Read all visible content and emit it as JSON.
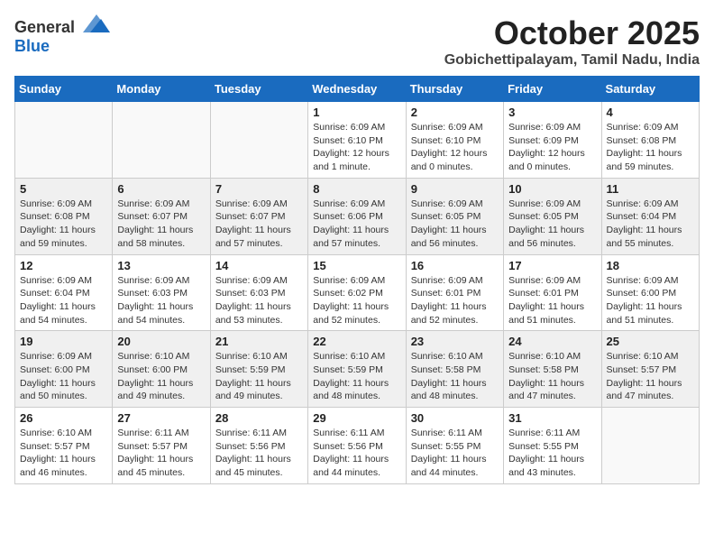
{
  "logo": {
    "general": "General",
    "blue": "Blue"
  },
  "title": "October 2025",
  "location": "Gobichettipalayam, Tamil Nadu, India",
  "headers": [
    "Sunday",
    "Monday",
    "Tuesday",
    "Wednesday",
    "Thursday",
    "Friday",
    "Saturday"
  ],
  "weeks": [
    [
      {
        "day": "",
        "info": ""
      },
      {
        "day": "",
        "info": ""
      },
      {
        "day": "",
        "info": ""
      },
      {
        "day": "1",
        "info": "Sunrise: 6:09 AM\nSunset: 6:10 PM\nDaylight: 12 hours\nand 1 minute."
      },
      {
        "day": "2",
        "info": "Sunrise: 6:09 AM\nSunset: 6:10 PM\nDaylight: 12 hours\nand 0 minutes."
      },
      {
        "day": "3",
        "info": "Sunrise: 6:09 AM\nSunset: 6:09 PM\nDaylight: 12 hours\nand 0 minutes."
      },
      {
        "day": "4",
        "info": "Sunrise: 6:09 AM\nSunset: 6:08 PM\nDaylight: 11 hours\nand 59 minutes."
      }
    ],
    [
      {
        "day": "5",
        "info": "Sunrise: 6:09 AM\nSunset: 6:08 PM\nDaylight: 11 hours\nand 59 minutes."
      },
      {
        "day": "6",
        "info": "Sunrise: 6:09 AM\nSunset: 6:07 PM\nDaylight: 11 hours\nand 58 minutes."
      },
      {
        "day": "7",
        "info": "Sunrise: 6:09 AM\nSunset: 6:07 PM\nDaylight: 11 hours\nand 57 minutes."
      },
      {
        "day": "8",
        "info": "Sunrise: 6:09 AM\nSunset: 6:06 PM\nDaylight: 11 hours\nand 57 minutes."
      },
      {
        "day": "9",
        "info": "Sunrise: 6:09 AM\nSunset: 6:05 PM\nDaylight: 11 hours\nand 56 minutes."
      },
      {
        "day": "10",
        "info": "Sunrise: 6:09 AM\nSunset: 6:05 PM\nDaylight: 11 hours\nand 56 minutes."
      },
      {
        "day": "11",
        "info": "Sunrise: 6:09 AM\nSunset: 6:04 PM\nDaylight: 11 hours\nand 55 minutes."
      }
    ],
    [
      {
        "day": "12",
        "info": "Sunrise: 6:09 AM\nSunset: 6:04 PM\nDaylight: 11 hours\nand 54 minutes."
      },
      {
        "day": "13",
        "info": "Sunrise: 6:09 AM\nSunset: 6:03 PM\nDaylight: 11 hours\nand 54 minutes."
      },
      {
        "day": "14",
        "info": "Sunrise: 6:09 AM\nSunset: 6:03 PM\nDaylight: 11 hours\nand 53 minutes."
      },
      {
        "day": "15",
        "info": "Sunrise: 6:09 AM\nSunset: 6:02 PM\nDaylight: 11 hours\nand 52 minutes."
      },
      {
        "day": "16",
        "info": "Sunrise: 6:09 AM\nSunset: 6:01 PM\nDaylight: 11 hours\nand 52 minutes."
      },
      {
        "day": "17",
        "info": "Sunrise: 6:09 AM\nSunset: 6:01 PM\nDaylight: 11 hours\nand 51 minutes."
      },
      {
        "day": "18",
        "info": "Sunrise: 6:09 AM\nSunset: 6:00 PM\nDaylight: 11 hours\nand 51 minutes."
      }
    ],
    [
      {
        "day": "19",
        "info": "Sunrise: 6:09 AM\nSunset: 6:00 PM\nDaylight: 11 hours\nand 50 minutes."
      },
      {
        "day": "20",
        "info": "Sunrise: 6:10 AM\nSunset: 6:00 PM\nDaylight: 11 hours\nand 49 minutes."
      },
      {
        "day": "21",
        "info": "Sunrise: 6:10 AM\nSunset: 5:59 PM\nDaylight: 11 hours\nand 49 minutes."
      },
      {
        "day": "22",
        "info": "Sunrise: 6:10 AM\nSunset: 5:59 PM\nDaylight: 11 hours\nand 48 minutes."
      },
      {
        "day": "23",
        "info": "Sunrise: 6:10 AM\nSunset: 5:58 PM\nDaylight: 11 hours\nand 48 minutes."
      },
      {
        "day": "24",
        "info": "Sunrise: 6:10 AM\nSunset: 5:58 PM\nDaylight: 11 hours\nand 47 minutes."
      },
      {
        "day": "25",
        "info": "Sunrise: 6:10 AM\nSunset: 5:57 PM\nDaylight: 11 hours\nand 47 minutes."
      }
    ],
    [
      {
        "day": "26",
        "info": "Sunrise: 6:10 AM\nSunset: 5:57 PM\nDaylight: 11 hours\nand 46 minutes."
      },
      {
        "day": "27",
        "info": "Sunrise: 6:11 AM\nSunset: 5:57 PM\nDaylight: 11 hours\nand 45 minutes."
      },
      {
        "day": "28",
        "info": "Sunrise: 6:11 AM\nSunset: 5:56 PM\nDaylight: 11 hours\nand 45 minutes."
      },
      {
        "day": "29",
        "info": "Sunrise: 6:11 AM\nSunset: 5:56 PM\nDaylight: 11 hours\nand 44 minutes."
      },
      {
        "day": "30",
        "info": "Sunrise: 6:11 AM\nSunset: 5:55 PM\nDaylight: 11 hours\nand 44 minutes."
      },
      {
        "day": "31",
        "info": "Sunrise: 6:11 AM\nSunset: 5:55 PM\nDaylight: 11 hours\nand 43 minutes."
      },
      {
        "day": "",
        "info": ""
      }
    ]
  ]
}
